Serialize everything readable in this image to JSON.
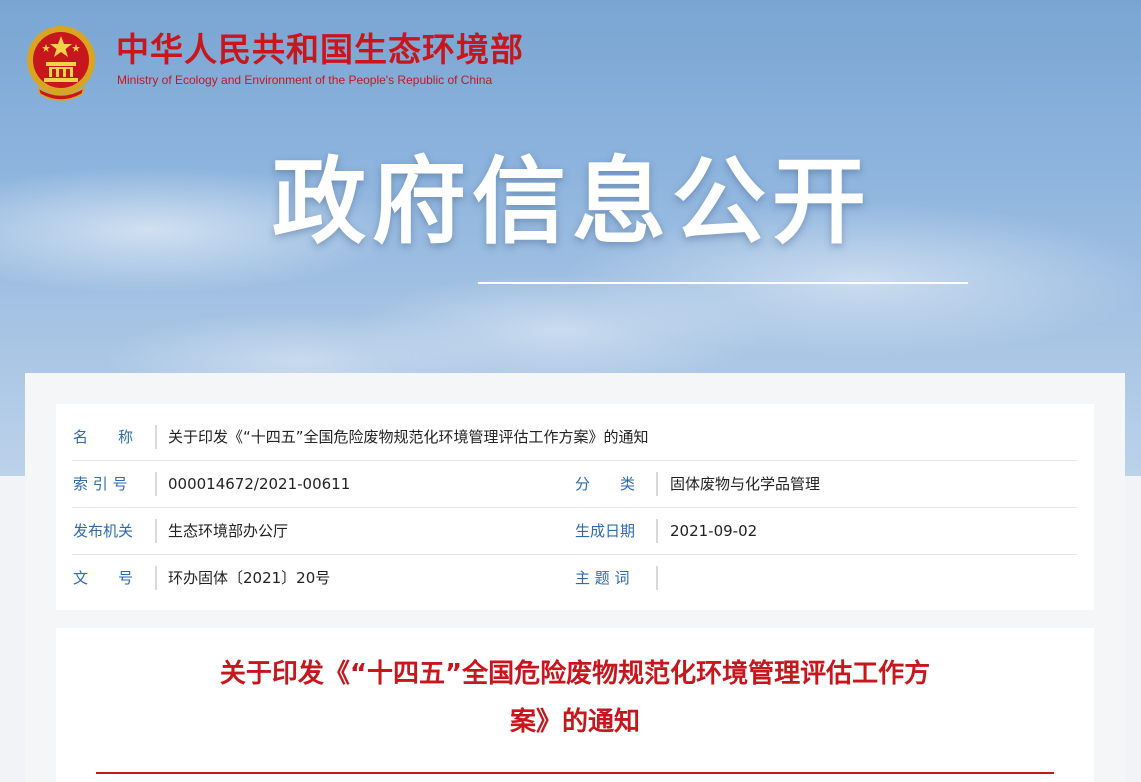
{
  "header": {
    "org_name_cn": "中华人民共和国生态环境部",
    "org_name_en": "Ministry of Ecology and Environment of the People's Republic of China",
    "emblem_icon": "national-emblem-icon",
    "brand_color": "#c8161d"
  },
  "banner": {
    "title": "政府信息公开"
  },
  "meta": {
    "name_label": "名　　称",
    "name_value": "关于印发《“十四五”全国危险废物规范化环境管理评估工作方案》的通知",
    "index_label": "索 引 号",
    "index_value": "000014672/2021-00611",
    "category_label": "分　　类",
    "category_value": "固体废物与化学品管理",
    "issuer_label": "发布机关",
    "issuer_value": "生态环境部办公厅",
    "date_label": "生成日期",
    "date_value": "2021-09-02",
    "docno_label": "文　　号",
    "docno_value": "环办固体〔2021〕20号",
    "keywords_label": "主 题 词",
    "keywords_value": ""
  },
  "document": {
    "title_line1": "关于印发《“十四五”全国危险废物规范化环境管理评估工作方",
    "title_line2": "案》的通知"
  }
}
